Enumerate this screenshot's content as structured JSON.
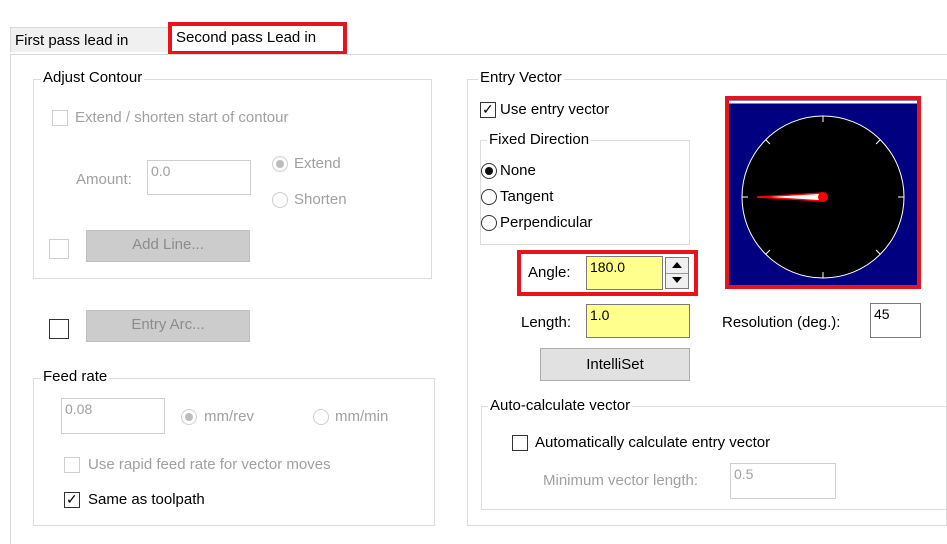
{
  "tabs": {
    "first": "First pass lead in",
    "second": "Second pass Lead in"
  },
  "adjust_contour": {
    "title": "Adjust Contour",
    "extend_label": "Extend / shorten start of contour",
    "amount_label": "Amount:",
    "amount_value": "0.0",
    "extend": "Extend",
    "shorten": "Shorten",
    "add_line": "Add Line..."
  },
  "entry_arc": {
    "label": "Entry Arc..."
  },
  "feed_rate": {
    "title": "Feed rate",
    "value": "0.08",
    "mm_rev": "mm/rev",
    "mm_min": "mm/min",
    "rapid_label": "Use rapid feed rate for vector moves",
    "same_label": "Same as toolpath"
  },
  "entry_vector": {
    "title": "Entry Vector",
    "use_label": "Use entry vector",
    "fixed_title": "Fixed Direction",
    "none": "None",
    "tangent": "Tangent",
    "perpendicular": "Perpendicular",
    "angle_label": "Angle:",
    "angle_value": "180.0",
    "length_label": "Length:",
    "length_value": "1.0",
    "resolution_label": "Resolution (deg.):",
    "resolution_value": "45",
    "intelliset": "IntelliSet",
    "dial_angle_deg": 180,
    "colors": {
      "dial_bg": "#000080",
      "needle": "#ff0000",
      "highlight": "#e8131b"
    }
  },
  "auto_calc": {
    "title": "Auto-calculate vector",
    "auto_label": "Automatically calculate entry vector",
    "min_label": "Minimum vector length:",
    "min_value": "0.5"
  }
}
